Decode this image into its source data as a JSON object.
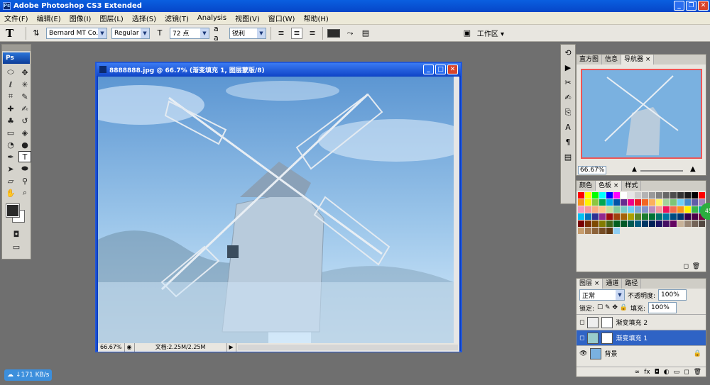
{
  "app": {
    "title": "Adobe Photoshop CS3 Extended",
    "logo_short": "Ps"
  },
  "menu": [
    "文件(F)",
    "编辑(E)",
    "图像(I)",
    "图层(L)",
    "选择(S)",
    "滤镜(T)",
    "Analysis",
    "视图(V)",
    "窗口(W)",
    "帮助(H)"
  ],
  "options": {
    "tool_glyph": "T",
    "font_family": "Bernard MT Co...",
    "font_style": "Regular",
    "font_size": "72 点",
    "aa_label": "a a",
    "aa_value": "锐利",
    "workspace": "工作区 ▾"
  },
  "document": {
    "title": "8888888.jpg @ 66.7% (渐变填充 1, 图层蒙版/8)",
    "zoom": "66.67%",
    "doc_size": "文档:2.25M/2.25M"
  },
  "navigator": {
    "tabs": [
      "直方图",
      "信息",
      "导航器 ×"
    ],
    "zoom": "66.67%"
  },
  "swatches": {
    "tabs": [
      "颜色",
      "色板 ×",
      "样式"
    ],
    "colors": [
      "#ff0000",
      "#ffff00",
      "#00ff00",
      "#00ffff",
      "#0000ff",
      "#ff00ff",
      "#ffffff",
      "#e6e6e6",
      "#cccccc",
      "#b3b3b3",
      "#999999",
      "#808080",
      "#666666",
      "#4d4d4d",
      "#333333",
      "#1a1a1a",
      "#000000",
      "#ff0000",
      "#f7941d",
      "#fff200",
      "#8dc63f",
      "#00a651",
      "#00aeef",
      "#0054a6",
      "#662d91",
      "#ec008c",
      "#ed1c24",
      "#f26522",
      "#fbaf5d",
      "#fff568",
      "#a3d39c",
      "#7cc576",
      "#6dcff6",
      "#448ccb",
      "#605ca8",
      "#a186be",
      "#f49ac1",
      "#f6989d",
      "#f9ad81",
      "#fdc68a",
      "#c4df9b",
      "#82ca9c",
      "#7accc8",
      "#6ecff6",
      "#7da7d9",
      "#8393ca",
      "#bd8cbf",
      "#f5989d",
      "#ed145b",
      "#f26c4f",
      "#f7941d",
      "#fff200",
      "#39b54a",
      "#00a99d",
      "#00bff3",
      "#0072bc",
      "#2e3192",
      "#92278f",
      "#9e0b0f",
      "#a0410d",
      "#a36209",
      "#aba000",
      "#598527",
      "#1a7b30",
      "#007236",
      "#00746b",
      "#0076a3",
      "#004a80",
      "#003471",
      "#32004b",
      "#4b0049",
      "#7b0046",
      "#790000",
      "#7b2e00",
      "#7d4900",
      "#827b00",
      "#406618",
      "#005e20",
      "#005826",
      "#005952",
      "#005b7f",
      "#003663",
      "#002157",
      "#1b1464",
      "#440e62",
      "#630460",
      "#c7b299",
      "#998675",
      "#736357",
      "#534741",
      "#c69c6d",
      "#a67c52",
      "#8c6239",
      "#754c24",
      "#603913",
      "#8fcef3"
    ]
  },
  "layers": {
    "tabs": [
      "图层 ×",
      "通道",
      "路径"
    ],
    "blend_mode": "正常",
    "opacity_label": "不透明度:",
    "opacity": "100%",
    "lock_label": "锁定:",
    "fill_label": "填充:",
    "fill": "100%",
    "items": [
      "渐变填充 2",
      "渐变填充 1",
      "背景"
    ]
  },
  "status": {
    "net_speed": "↓171 KB/s",
    "badge": "45"
  }
}
